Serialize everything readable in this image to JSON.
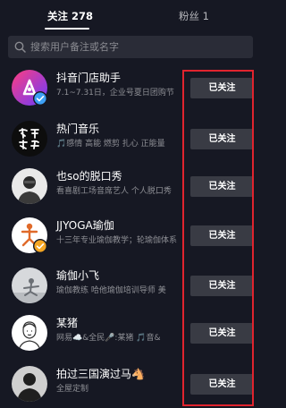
{
  "tabs": {
    "following": "关注 278",
    "fans": "粉丝 1"
  },
  "search": {
    "placeholder": "搜索用户备注或名字"
  },
  "follow_button_label": "已关注",
  "users": [
    {
      "name": "抖音门店助手",
      "desc": "7.1~7.31日，企业号夏日团购节",
      "verified": true,
      "avatar": "douyin-logo"
    },
    {
      "name": "热门音乐",
      "desc": "🎵感情 高能 燃剪 扎心 正能量",
      "verified": false,
      "avatar": "calligraphy-text"
    },
    {
      "name": "也so的脱口秀",
      "desc": "看喜剧工场音席艺人 个人脱口秀",
      "verified": false,
      "avatar": "person-photo"
    },
    {
      "name": "JJYOGA瑜伽",
      "desc": "十三年专业瑜伽教学；轮瑜伽体系",
      "verified": true,
      "avatar": "yoga-pose"
    },
    {
      "name": "瑜伽小飞",
      "desc": "瑜伽教练 哈他瑜伽培训导师 美",
      "verified": false,
      "avatar": "yoga-photo"
    },
    {
      "name": "某猪",
      "desc": "网易☁️&全民🎤:某猪 🎵音&",
      "verified": false,
      "avatar": "sketch-portrait"
    },
    {
      "name": "拍过三国演过马🐴",
      "desc": "全屋定制",
      "verified": false,
      "avatar": "person-dark"
    }
  ],
  "colors": {
    "background": "#161823",
    "search_bg": "#2a2c37",
    "button_bg": "#393b44",
    "highlight": "#e0242e",
    "verified_badge": "#3da0f5",
    "orange_badge": "#f5a623"
  }
}
